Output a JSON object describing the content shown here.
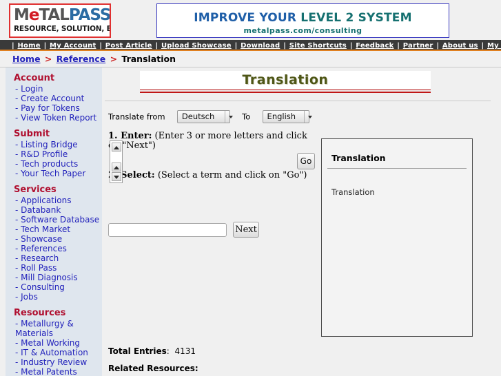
{
  "logo": {
    "part1": "M",
    "part2": "e",
    "part3": "TAL",
    "part4": "PASS",
    "tagline": "RESOURCE, SOLUTION, E-BIZ"
  },
  "banner": {
    "line1a": "IMPROVE YOUR ",
    "line1b": "LEVEL 2 SYSTEM",
    "line2": "metalpass.com/consulting"
  },
  "nav": {
    "separator": "|",
    "items": [
      "Home",
      "My Account",
      "Post Article",
      "Upload Showcase",
      "Download",
      "Site Shortcuts",
      "Feedback",
      "Partner",
      "About us",
      "My Tokens"
    ]
  },
  "breadcrumb": {
    "home": "Home",
    "arrow": ">",
    "section": "Reference",
    "current": "Translation"
  },
  "sidebar": {
    "groups": [
      {
        "title": "Account",
        "items": [
          "- Login",
          "- Create Account",
          "- Pay for Tokens",
          "- View Token Report"
        ]
      },
      {
        "title": "Submit",
        "items": [
          "- Listing Bridge",
          "- R&D Profile",
          "- Tech products",
          "- Your Tech Paper"
        ]
      },
      {
        "title": "Services",
        "items": [
          "- Applications",
          "- Databank",
          "- Software Database",
          "- Tech Market",
          "- Showcase",
          "- References",
          "- Research",
          "- Roll Pass",
          "- Mill Diagnosis",
          "- Consulting",
          "- Jobs"
        ]
      },
      {
        "title": "Resources",
        "items": [
          "- Metallurgy & Materials",
          "- Metal Working",
          "- IT & Automation",
          "- Industry Review",
          "- Metal Patents"
        ]
      }
    ]
  },
  "main": {
    "page_title": "Translation",
    "translate_from_label": "Translate from",
    "to_label": "To",
    "source_language": "Deutsch",
    "target_language": "English",
    "step1_number": "1. Enter:",
    "step1_hint": "(Enter 3 or more letters and click on \"Next\")",
    "step2_number": "2. Select:",
    "step2_hint": "(Select a term and click on \"Go\")",
    "word_input_value": "",
    "word_input_placeholder": "",
    "next_button": "Next",
    "go_button": "Go",
    "total_entries_label": "Total Entries",
    "total_entries_sep": ":",
    "total_entries_value": "4131",
    "related_resources_label": "Related Resources:"
  },
  "result_panel": {
    "title": "Translation",
    "body": "Translation"
  },
  "colors": {
    "accent_red": "#b01030",
    "link_blue": "#2222bb",
    "nav_bg": "#3a3a3a",
    "nav_underline": "#e08020",
    "sidebar_bg": "#dfe6ee",
    "title_olive": "#4e5616",
    "rule_red": "#c01818"
  }
}
